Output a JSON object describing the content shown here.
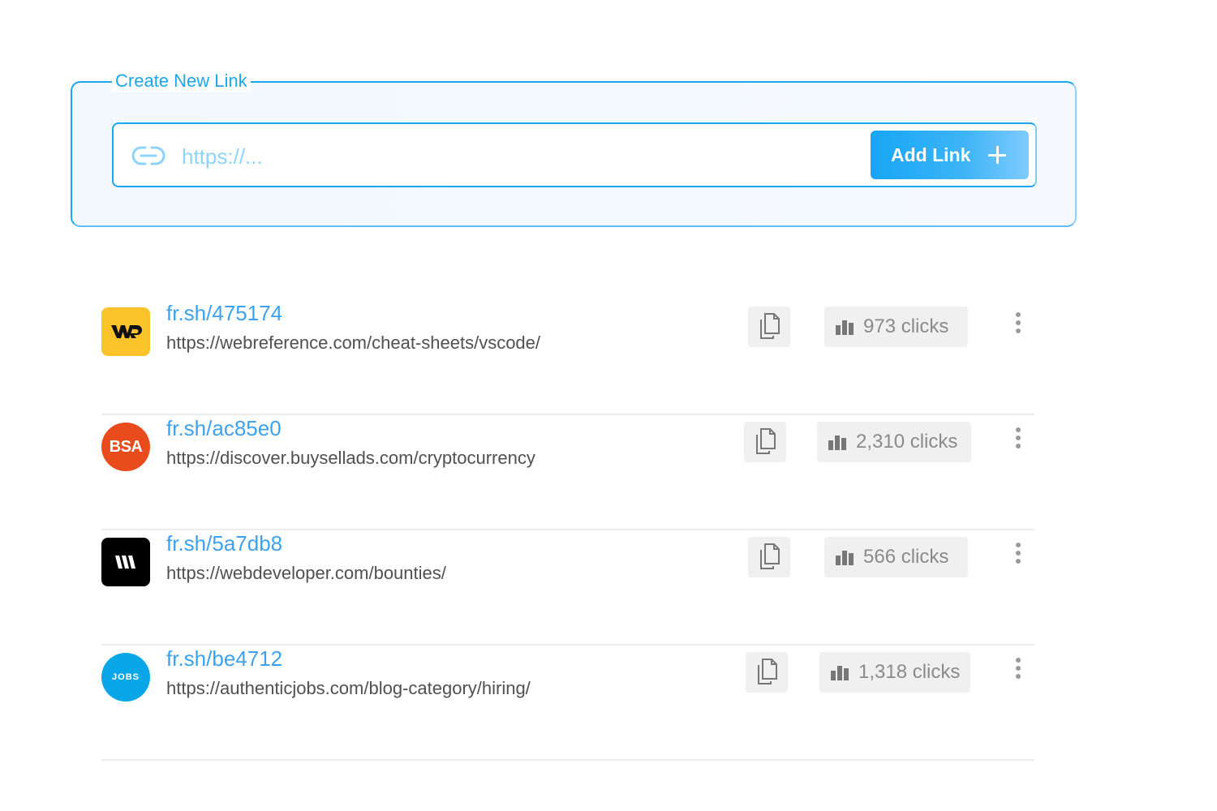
{
  "create": {
    "legend": "Create New Link",
    "input_value": "",
    "input_placeholder": "https://...",
    "add_button_label": "Add Link",
    "accent_color": "#1aa7f0"
  },
  "links": [
    {
      "logo": {
        "text": "WR",
        "shape": "rounded-square",
        "bg": "#fcc42a",
        "fg": "#111111",
        "icon": "webreference-logo"
      },
      "short_url": "fr.sh/475174",
      "long_url": "https://webreference.com/cheat-sheets/vscode/",
      "clicks_label": "973 clicks",
      "clicks": 973
    },
    {
      "logo": {
        "text": "BSA",
        "shape": "circle",
        "bg": "#ea4b1c",
        "fg": "#ffffff",
        "icon": "buysellads-logo"
      },
      "short_url": "fr.sh/ac85e0",
      "long_url": "https://discover.buysellads.com/cryptocurrency",
      "clicks_label": "2,310 clicks",
      "clicks": 2310
    },
    {
      "logo": {
        "text": "W",
        "shape": "rounded-square",
        "bg": "#000000",
        "fg": "#ffffff",
        "icon": "webdeveloper-logo"
      },
      "short_url": "fr.sh/5a7db8",
      "long_url": "https://webdeveloper.com/bounties/",
      "clicks_label": "566 clicks",
      "clicks": 566
    },
    {
      "logo": {
        "text": "JOBS",
        "shape": "circle",
        "bg": "#0aa7e8",
        "fg": "#ffffff",
        "icon": "authenticjobs-logo"
      },
      "short_url": "fr.sh/be4712",
      "long_url": "https://authenticjobs.com/blog-category/hiring/",
      "clicks_label": "1,318 clicks",
      "clicks": 1318
    }
  ]
}
